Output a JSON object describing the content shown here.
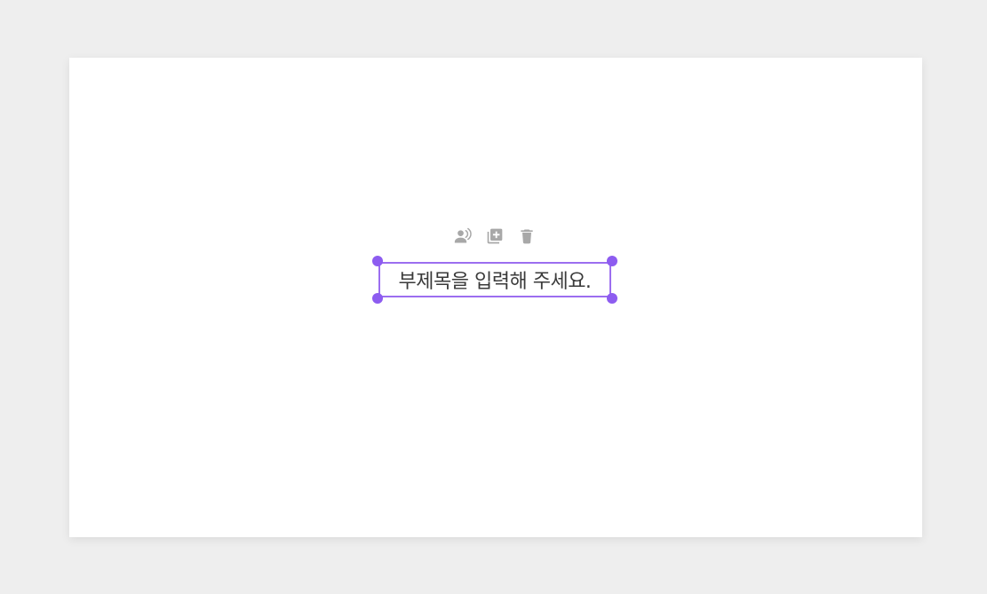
{
  "slide": {
    "subtitle_placeholder": "부제목을 입력해 주세요."
  },
  "toolbar": {
    "icons": [
      "voice-narration-icon",
      "add-copy-icon",
      "trash-icon"
    ]
  },
  "colors": {
    "background": "#eeeeee",
    "slide": "#ffffff",
    "selection": "#9c6ef0",
    "handle": "#8d5cf0",
    "icon": "#a8a8a8",
    "text": "#3a3a3a"
  }
}
